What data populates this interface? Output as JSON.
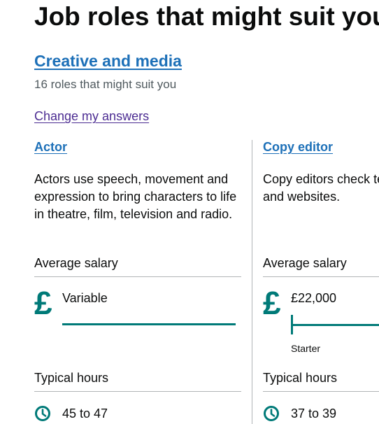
{
  "page": {
    "title": "Job roles that might suit you"
  },
  "category": {
    "link_label": "Creative and media",
    "roles_count_text": "16 roles that might suit you",
    "change_answers_label": "Change my answers"
  },
  "roles": [
    {
      "title": "Actor",
      "description": "Actors use speech, movement and expression to bring characters to life in theatre, film, television and radio.",
      "salary_label": "Average salary",
      "salary_value": "Variable",
      "salary_icon": "pound-icon",
      "salary_icon_glyph": "£",
      "hours_label": "Typical hours",
      "hours_value": "45 to 47",
      "hours_icon": "clock-icon"
    },
    {
      "title": "Copy editor",
      "description": "Copy editors check text published in books, journals and websites.",
      "salary_label": "Average salary",
      "salary_value": "£22,000",
      "salary_level_label": "Starter",
      "salary_icon": "pound-icon",
      "salary_icon_glyph": "£",
      "hours_label": "Typical hours",
      "hours_value": "37 to 39",
      "hours_icon": "clock-icon"
    }
  ],
  "colors": {
    "link": "#1d70b8",
    "visited_link": "#4c2c92",
    "accent": "#007a78",
    "secondary_text": "#505a5f",
    "divider": "#b1b4b6"
  }
}
